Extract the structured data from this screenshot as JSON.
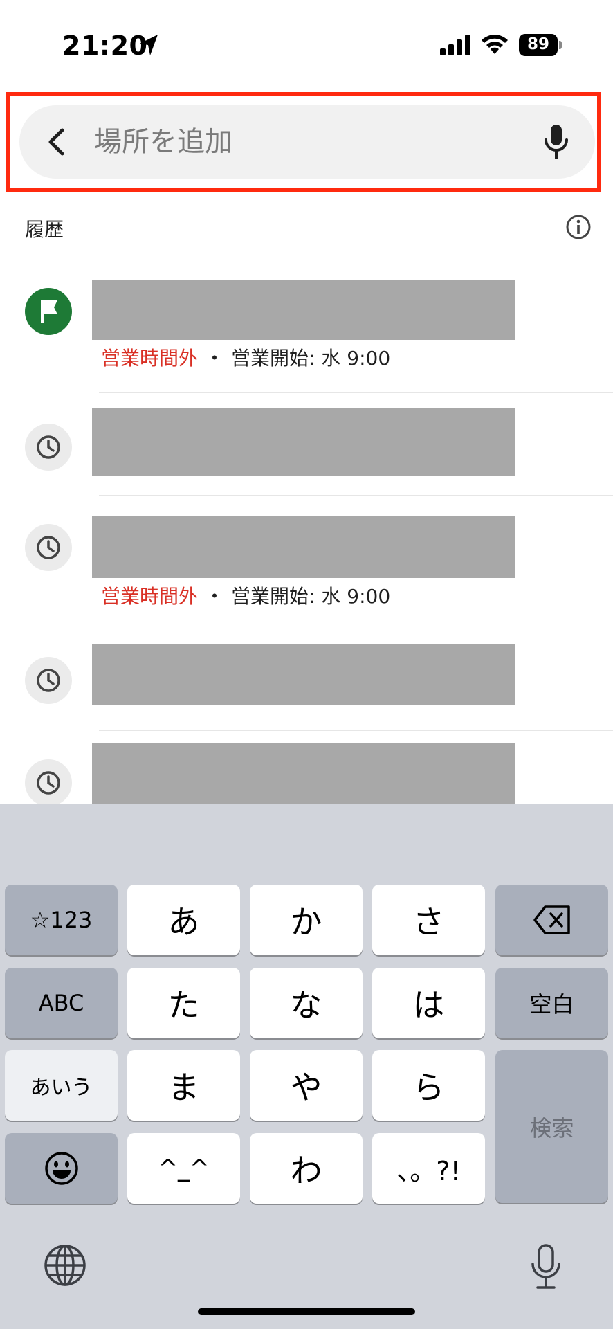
{
  "status_bar": {
    "time": "21:20",
    "battery": "89",
    "icons": [
      "location-arrow-icon",
      "signal-icon",
      "wifi-icon",
      "battery-icon"
    ]
  },
  "search": {
    "placeholder": "場所を追加",
    "value": "",
    "back_icon": "chevron-left-icon",
    "mic_icon": "microphone-icon"
  },
  "history": {
    "title": "履歴",
    "info_icon": "info-icon",
    "items": [
      {
        "icon": "flag-icon",
        "status_closed": "営業時間外",
        "separator": "・",
        "opens": "営業開始: 水 9:00"
      },
      {
        "icon": "clock-icon"
      },
      {
        "icon": "clock-icon",
        "status_closed": "営業時間外",
        "separator": "・",
        "opens": "営業開始: 水 9:00"
      },
      {
        "icon": "clock-icon"
      },
      {
        "icon": "clock-icon"
      }
    ]
  },
  "keyboard": {
    "rows": [
      [
        "☆123",
        "あ",
        "か",
        "さ",
        "delete"
      ],
      [
        "ABC",
        "た",
        "な",
        "は",
        "空白"
      ],
      [
        "あいう",
        "ま",
        "や",
        "ら",
        "検索"
      ],
      [
        "emoji",
        "^_^",
        "わ",
        "、。?!"
      ]
    ],
    "keys": {
      "num": "☆123",
      "a": "あ",
      "ka": "か",
      "sa": "さ",
      "abc": "ABC",
      "ta": "た",
      "na": "な",
      "ha": "は",
      "space": "空白",
      "aiu": "あいう",
      "ma": "ま",
      "ya": "や",
      "ra": "ら",
      "search": "検索",
      "kaomoji": "^_^",
      "wa": "わ",
      "punct": "、。?!"
    },
    "icons": [
      "delete-icon",
      "emoji-icon",
      "globe-icon",
      "dictation-mic-icon"
    ]
  },
  "colors": {
    "highlight": "#ff2a0f",
    "closed_text": "#d93025",
    "flag_icon_bg": "#1e7a36",
    "keyboard_bg": "#d1d4db"
  }
}
